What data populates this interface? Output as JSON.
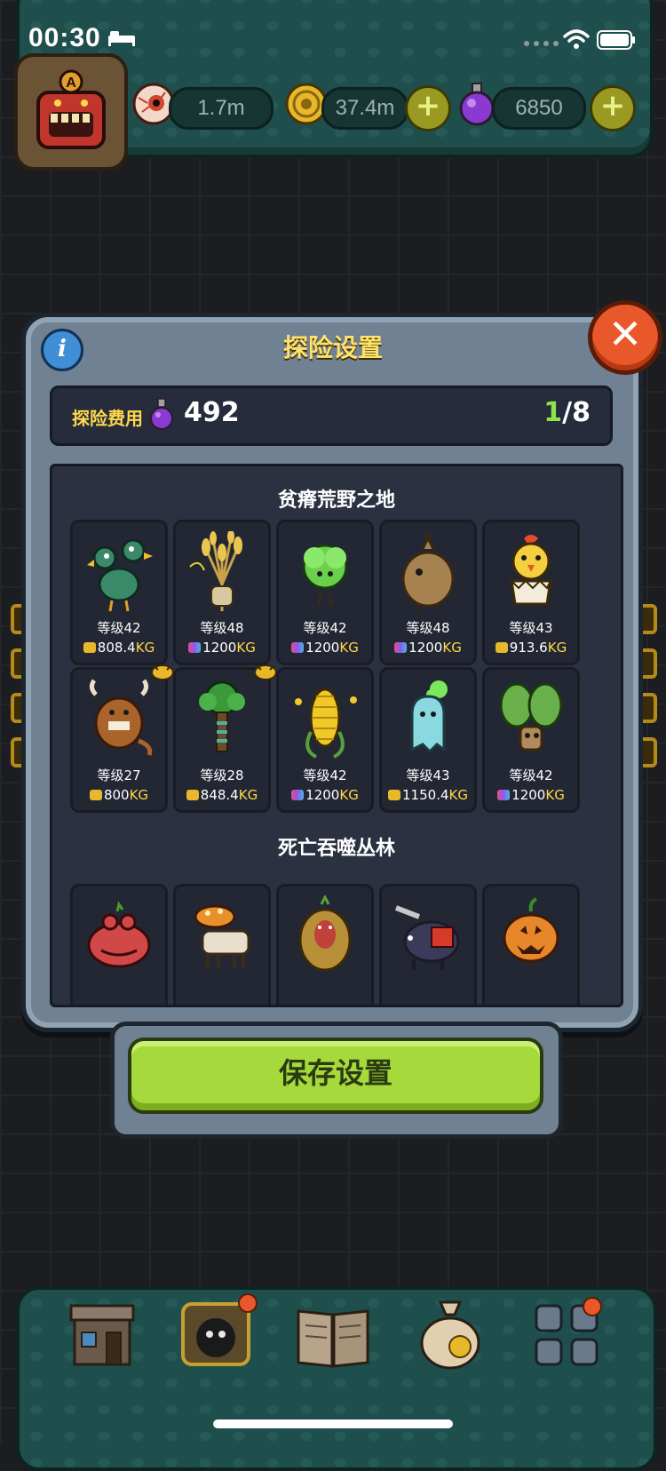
{
  "status_bar": {
    "time": "00:30"
  },
  "resources": [
    {
      "name": "eyeball",
      "value": "1.7m"
    },
    {
      "name": "coin",
      "value": "37.4m"
    },
    {
      "name": "potion",
      "value": "6850"
    }
  ],
  "panel": {
    "title": "探险设置",
    "cost_label": "探险费用",
    "cost_value": "492",
    "count_current": "1",
    "count_total": "/8",
    "save_label": "保存设置"
  },
  "sections": [
    {
      "title": "贫瘠荒野之地",
      "cards": [
        {
          "level": "等级42",
          "weight": "808.4",
          "unit": "KG",
          "bag": "gold",
          "creature": "green-bird"
        },
        {
          "level": "等级48",
          "weight": "1200",
          "unit": "KG",
          "bag": "rainbow",
          "creature": "wheat"
        },
        {
          "level": "等级42",
          "weight": "1200",
          "unit": "KG",
          "bag": "rainbow",
          "creature": "lettuce"
        },
        {
          "level": "等级48",
          "weight": "1200",
          "unit": "KG",
          "bag": "rainbow",
          "creature": "sack"
        },
        {
          "level": "等级43",
          "weight": "913.6",
          "unit": "KG",
          "bag": "gold",
          "creature": "chick"
        },
        {
          "level": "等级27",
          "weight": "800",
          "unit": "KG",
          "bag": "gold",
          "creature": "yak"
        },
        {
          "level": "等级28",
          "weight": "848.4",
          "unit": "KG",
          "bag": "gold",
          "creature": "tree"
        },
        {
          "level": "等级42",
          "weight": "1200",
          "unit": "KG",
          "bag": "rainbow",
          "creature": "corn"
        },
        {
          "level": "等级43",
          "weight": "1150.4",
          "unit": "KG",
          "bag": "gold",
          "creature": "ghost"
        },
        {
          "level": "等级42",
          "weight": "1200",
          "unit": "KG",
          "bag": "rainbow",
          "creature": "cactus"
        }
      ]
    },
    {
      "title": "死亡吞噬丛林",
      "cards": [
        {
          "creature": "frog"
        },
        {
          "creature": "mushroom-goat"
        },
        {
          "creature": "monkey"
        },
        {
          "creature": "chainsaw-pig"
        },
        {
          "creature": "pumpkin"
        }
      ]
    }
  ],
  "colors": {
    "accent_yellow": "#ffe16a",
    "save_green": "#a6d93c",
    "count_green": "#8ee34a",
    "close_orange": "#e9582a",
    "teal_bar": "#1f4f4c"
  },
  "bottom_nav": [
    {
      "icon": "shop-building-icon"
    },
    {
      "icon": "monster-cage-icon",
      "notification": true
    },
    {
      "icon": "book-icon"
    },
    {
      "icon": "money-bag-icon"
    },
    {
      "icon": "grid-menu-icon",
      "notification": true
    }
  ]
}
